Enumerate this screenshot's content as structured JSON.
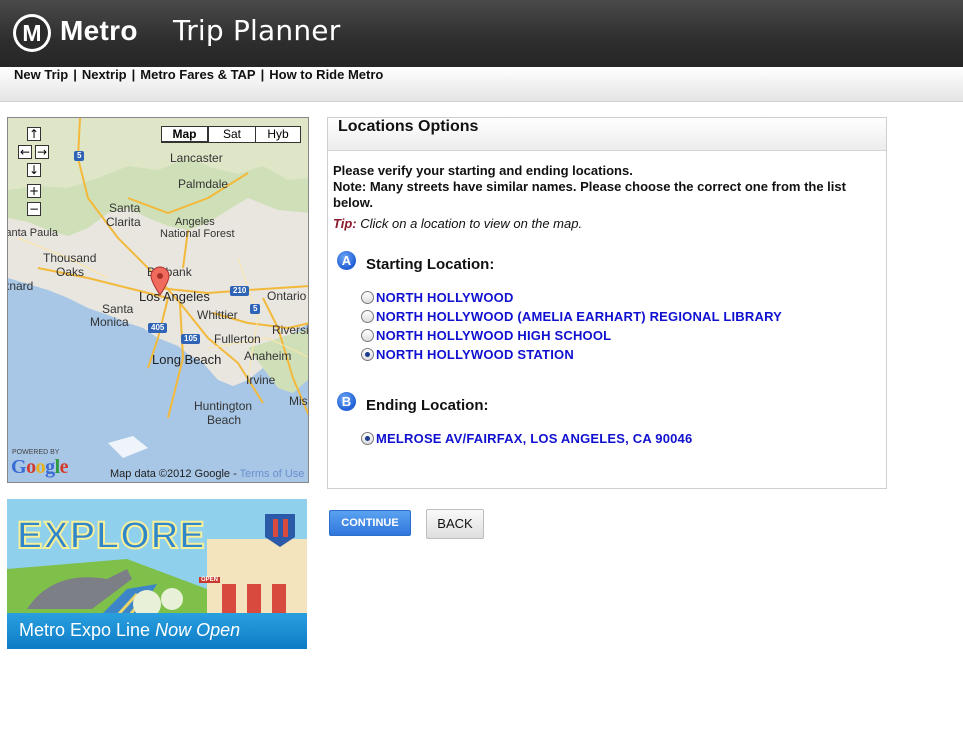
{
  "header": {
    "logo_letter": "M",
    "brand": "Metro",
    "title": "Trip Planner"
  },
  "nav": {
    "items": [
      "New Trip",
      "Nextrip",
      "Metro Fares & TAP",
      "How to Ride Metro"
    ],
    "separator": "|"
  },
  "map": {
    "types": [
      "Map",
      "Sat",
      "Hyb"
    ],
    "active_type": "Map",
    "controls": {
      "up": "↑",
      "left": "←",
      "right": "→",
      "down": "↓",
      "zoom_in": "+",
      "zoom_out": "−"
    },
    "labels": [
      "Lancaster",
      "Palmdale",
      "Santa",
      "Clarita",
      "Angeles",
      "National Forest",
      "Santa Paula",
      "Thousand",
      "Oaks",
      "Oxnard",
      "Burbank",
      "Los Angeles",
      "Ontario",
      "Santa",
      "Monica",
      "Whittier",
      "Riverside",
      "Fullerton",
      "Long Beach",
      "Anaheim",
      "Irvine",
      "Huntington",
      "Beach",
      "Mission"
    ],
    "shields": [
      "5",
      "210",
      "405",
      "105",
      "5"
    ],
    "powered_by": "POWERED BY",
    "google": "Google",
    "attribution": "Map data ©2012 Google - ",
    "terms_link": "Terms of Use"
  },
  "banner": {
    "headline": "EXPLORE",
    "line_prefix": "Metro Expo Line",
    "line_suffix": "Now Open",
    "sign": "OPEN"
  },
  "panel": {
    "title": "Locations Options",
    "instructions_1": "Please verify your starting and ending locations.",
    "instructions_2": "Note: Many streets have similar names. Please choose the correct one from the list below.",
    "tip_label": "Tip:",
    "tip_text": "Click on a location to view on the map.",
    "start": {
      "badge": "A",
      "title": "Starting Location:",
      "options": [
        {
          "label": "NORTH HOLLYWOOD",
          "checked": false
        },
        {
          "label": "NORTH HOLLYWOOD (AMELIA EARHART) REGIONAL LIBRARY",
          "checked": false
        },
        {
          "label": "NORTH HOLLYWOOD HIGH SCHOOL",
          "checked": false
        },
        {
          "label": "NORTH HOLLYWOOD STATION",
          "checked": true
        }
      ]
    },
    "end": {
      "badge": "B",
      "title": "Ending Location:",
      "options": [
        {
          "label": "MELROSE AV/FAIRFAX, LOS ANGELES, CA 90046",
          "checked": true
        }
      ]
    }
  },
  "buttons": {
    "continue": "CONTINUE",
    "back": "BACK"
  }
}
